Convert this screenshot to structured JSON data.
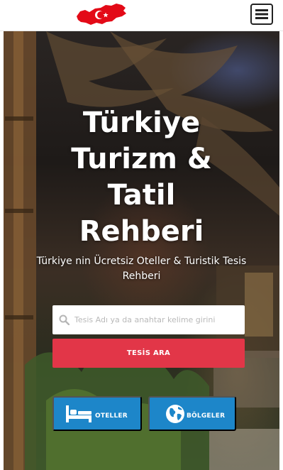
{
  "header": {
    "logo_icon": "turkey-flag-map-icon",
    "menu_icon": "hamburger-menu-icon"
  },
  "hero": {
    "title_lines": [
      "Türkiye",
      "Turizm &",
      "Tatil",
      "Rehberi"
    ],
    "subtitle": "Türkiye nin Ücretsiz Oteller & Turistik Tesis Rehberi"
  },
  "search": {
    "icon": "search-icon",
    "placeholder": "Tesis Adı ya da anahtar kelime girini",
    "button_label": "TESİS ARA"
  },
  "categories": [
    {
      "label": "OTELLER",
      "icon": "bed-icon"
    },
    {
      "label": "BÖLGELER",
      "icon": "globe-icon"
    }
  ],
  "colors": {
    "search_button": "#e23648",
    "category_button": "#1d86c9",
    "logo_red": "#e30a17"
  }
}
